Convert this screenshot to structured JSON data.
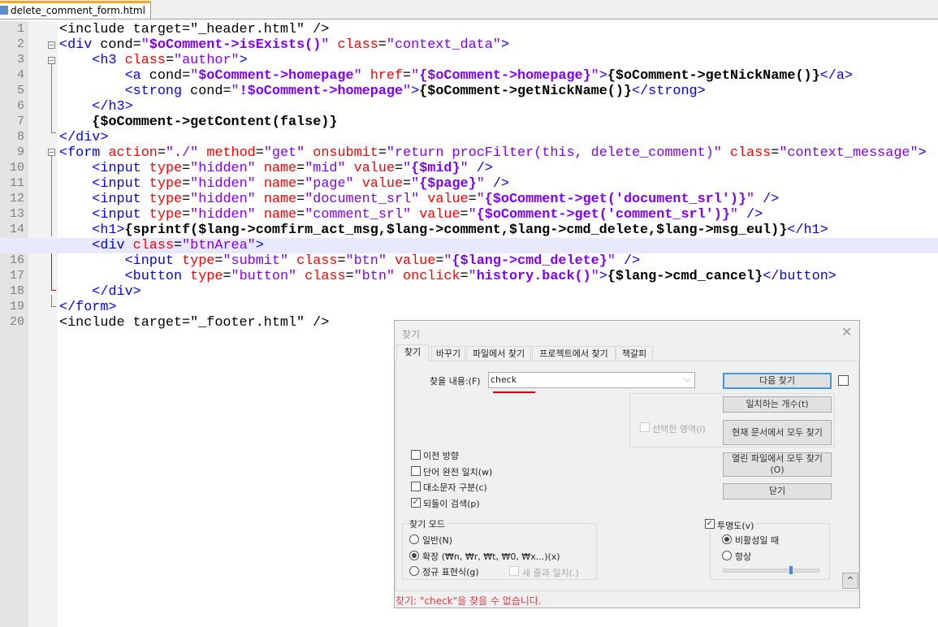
{
  "tab": {
    "filename": "delete_comment_form.html"
  },
  "editor": {
    "lines": [
      [
        [
          "p",
          "<include target=\"_header.html\" />"
        ]
      ],
      [
        [
          "t",
          "<div "
        ],
        [
          "p",
          "cond="
        ],
        [
          "v",
          "\""
        ],
        [
          "b",
          "$oComment->isExists()"
        ],
        [
          "v",
          "\" "
        ],
        [
          "a",
          "class"
        ],
        [
          "p",
          "="
        ],
        [
          "v",
          "\"context_data\""
        ],
        [
          "t",
          ">"
        ]
      ],
      [
        [
          "p",
          "    "
        ],
        [
          "t",
          "<h3 "
        ],
        [
          "a",
          "class"
        ],
        [
          "p",
          "="
        ],
        [
          "v",
          "\"author\""
        ],
        [
          "t",
          ">"
        ]
      ],
      [
        [
          "p",
          "        "
        ],
        [
          "t",
          "<a "
        ],
        [
          "p",
          "cond="
        ],
        [
          "v",
          "\""
        ],
        [
          "b",
          "$oComment->homepage"
        ],
        [
          "v",
          "\" "
        ],
        [
          "a",
          "href"
        ],
        [
          "p",
          "="
        ],
        [
          "v",
          "\""
        ],
        [
          "b",
          "{$oComment->homepage}"
        ],
        [
          "v",
          "\""
        ],
        [
          "t",
          ">"
        ],
        [
          "x",
          "{$oComment->getNickName()}"
        ],
        [
          "t",
          "</a>"
        ]
      ],
      [
        [
          "p",
          "        "
        ],
        [
          "t",
          "<strong "
        ],
        [
          "p",
          "cond="
        ],
        [
          "v",
          "\""
        ],
        [
          "b",
          "!$oComment->homepage"
        ],
        [
          "v",
          "\""
        ],
        [
          "t",
          ">"
        ],
        [
          "x",
          "{$oComment->getNickName()}"
        ],
        [
          "t",
          "</strong>"
        ]
      ],
      [
        [
          "p",
          "    "
        ],
        [
          "t",
          "</h3>"
        ]
      ],
      [
        [
          "p",
          "    "
        ],
        [
          "x",
          "{$oComment->getContent(false)}"
        ]
      ],
      [
        [
          "t",
          "</div>"
        ]
      ],
      [
        [
          "t",
          "<form "
        ],
        [
          "a",
          "action"
        ],
        [
          "p",
          "="
        ],
        [
          "v",
          "\"./\" "
        ],
        [
          "a",
          "method"
        ],
        [
          "p",
          "="
        ],
        [
          "v",
          "\"get\" "
        ],
        [
          "a",
          "onsubmit"
        ],
        [
          "p",
          "="
        ],
        [
          "v",
          "\"return procFilter(this, delete_comment)\" "
        ],
        [
          "a",
          "class"
        ],
        [
          "p",
          "="
        ],
        [
          "v",
          "\"context_message\""
        ],
        [
          "t",
          ">"
        ]
      ],
      [
        [
          "p",
          "    "
        ],
        [
          "t",
          "<input "
        ],
        [
          "a",
          "type"
        ],
        [
          "p",
          "="
        ],
        [
          "v",
          "\"hidden\" "
        ],
        [
          "a",
          "name"
        ],
        [
          "p",
          "="
        ],
        [
          "v",
          "\"mid\" "
        ],
        [
          "a",
          "value"
        ],
        [
          "p",
          "="
        ],
        [
          "v",
          "\""
        ],
        [
          "b",
          "{$mid}"
        ],
        [
          "v",
          "\" "
        ],
        [
          "t",
          "/>"
        ]
      ],
      [
        [
          "p",
          "    "
        ],
        [
          "t",
          "<input "
        ],
        [
          "a",
          "type"
        ],
        [
          "p",
          "="
        ],
        [
          "v",
          "\"hidden\" "
        ],
        [
          "a",
          "name"
        ],
        [
          "p",
          "="
        ],
        [
          "v",
          "\"page\" "
        ],
        [
          "a",
          "value"
        ],
        [
          "p",
          "="
        ],
        [
          "v",
          "\""
        ],
        [
          "b",
          "{$page}"
        ],
        [
          "v",
          "\" "
        ],
        [
          "t",
          "/>"
        ]
      ],
      [
        [
          "p",
          "    "
        ],
        [
          "t",
          "<input "
        ],
        [
          "a",
          "type"
        ],
        [
          "p",
          "="
        ],
        [
          "v",
          "\"hidden\" "
        ],
        [
          "a",
          "name"
        ],
        [
          "p",
          "="
        ],
        [
          "v",
          "\"document_srl\" "
        ],
        [
          "a",
          "value"
        ],
        [
          "p",
          "="
        ],
        [
          "v",
          "\""
        ],
        [
          "b",
          "{$oComment->get('document_srl')}"
        ],
        [
          "v",
          "\" "
        ],
        [
          "t",
          "/>"
        ]
      ],
      [
        [
          "p",
          "    "
        ],
        [
          "t",
          "<input "
        ],
        [
          "a",
          "type"
        ],
        [
          "p",
          "="
        ],
        [
          "v",
          "\"hidden\" "
        ],
        [
          "a",
          "name"
        ],
        [
          "p",
          "="
        ],
        [
          "v",
          "\"comment_srl\" "
        ],
        [
          "a",
          "value"
        ],
        [
          "p",
          "="
        ],
        [
          "v",
          "\""
        ],
        [
          "b",
          "{$oComment->get('comment_srl')}"
        ],
        [
          "v",
          "\" "
        ],
        [
          "t",
          "/>"
        ]
      ],
      [
        [
          "p",
          "    "
        ],
        [
          "t",
          "<h1>"
        ],
        [
          "x",
          "{sprintf($lang->comfirm_act_msg,$lang->comment,$lang->cmd_delete,$lang->msg_eul)}"
        ],
        [
          "t",
          "</h1>"
        ]
      ],
      [
        [
          "p",
          "    "
        ],
        [
          "t",
          "<div "
        ],
        [
          "a",
          "class"
        ],
        [
          "p",
          "="
        ],
        [
          "v",
          "\"btnArea\""
        ],
        [
          "t",
          ">"
        ]
      ],
      [
        [
          "p",
          "        "
        ],
        [
          "t",
          "<input "
        ],
        [
          "a",
          "type"
        ],
        [
          "p",
          "="
        ],
        [
          "v",
          "\"submit\" "
        ],
        [
          "a",
          "class"
        ],
        [
          "p",
          "="
        ],
        [
          "v",
          "\"btn\" "
        ],
        [
          "a",
          "value"
        ],
        [
          "p",
          "="
        ],
        [
          "v",
          "\""
        ],
        [
          "b",
          "{$lang->cmd_delete}"
        ],
        [
          "v",
          "\" "
        ],
        [
          "t",
          "/>"
        ]
      ],
      [
        [
          "p",
          "        "
        ],
        [
          "t",
          "<button "
        ],
        [
          "a",
          "type"
        ],
        [
          "p",
          "="
        ],
        [
          "v",
          "\"button\" "
        ],
        [
          "a",
          "class"
        ],
        [
          "p",
          "="
        ],
        [
          "v",
          "\"btn\" "
        ],
        [
          "a",
          "onclick"
        ],
        [
          "p",
          "="
        ],
        [
          "v",
          "\""
        ],
        [
          "b",
          "history.back()"
        ],
        [
          "v",
          "\""
        ],
        [
          "t",
          ">"
        ],
        [
          "x",
          "{$lang->cmd_cancel}"
        ],
        [
          "t",
          "</button>"
        ]
      ],
      [
        [
          "p",
          "    "
        ],
        [
          "t",
          "</div>"
        ]
      ],
      [
        [
          "t",
          "</form>"
        ]
      ],
      [
        [
          "p",
          "<include target=\"_footer.html\" />"
        ]
      ]
    ],
    "current_line": 15
  },
  "dialog": {
    "title": "찾기",
    "tabs": [
      "찾기",
      "바꾸기",
      "파일에서 찾기",
      "프로젝트에서 찾기",
      "책갈피"
    ],
    "find_label": "찾을 내용:(F)",
    "find_value": "check",
    "buttons": {
      "find_next": "다음 찾기",
      "count": "일치하는 개수(t)",
      "find_all_current": "현재 문서에서 모두 찾기",
      "find_all_open": "열린 파일에서 모두 찾기",
      "find_all_open_2": "(O)",
      "close": "닫기",
      "collapse": "^"
    },
    "in_selection": "선택한 영역(l)",
    "options": [
      {
        "label": "이전 방향",
        "checked": false
      },
      {
        "label": "단어 완전 일치(w)",
        "checked": false
      },
      {
        "label": "대소문자 구분(c)",
        "checked": false
      },
      {
        "label": "되돌이 검색(p)",
        "checked": true
      }
    ],
    "mode": {
      "title": "찾기 모드",
      "options": [
        {
          "label": "일반(N)",
          "selected": false
        },
        {
          "label": "확장 (₩n, ₩r, ₩t, ₩0, ₩x...)(x)",
          "selected": true
        },
        {
          "label": "정규 표현식(g)",
          "selected": false
        }
      ],
      "dot_newline": "새 줄과 일치(.)"
    },
    "transparency": {
      "label": "투명도(v)",
      "checked": true,
      "options": [
        {
          "label": "비활성일 때",
          "selected": true
        },
        {
          "label": "항상",
          "selected": false
        }
      ],
      "level": 0.72
    },
    "status": "찾기: \"check\"을 찾을 수 없습니다.",
    "status_color": "#e0404a"
  }
}
